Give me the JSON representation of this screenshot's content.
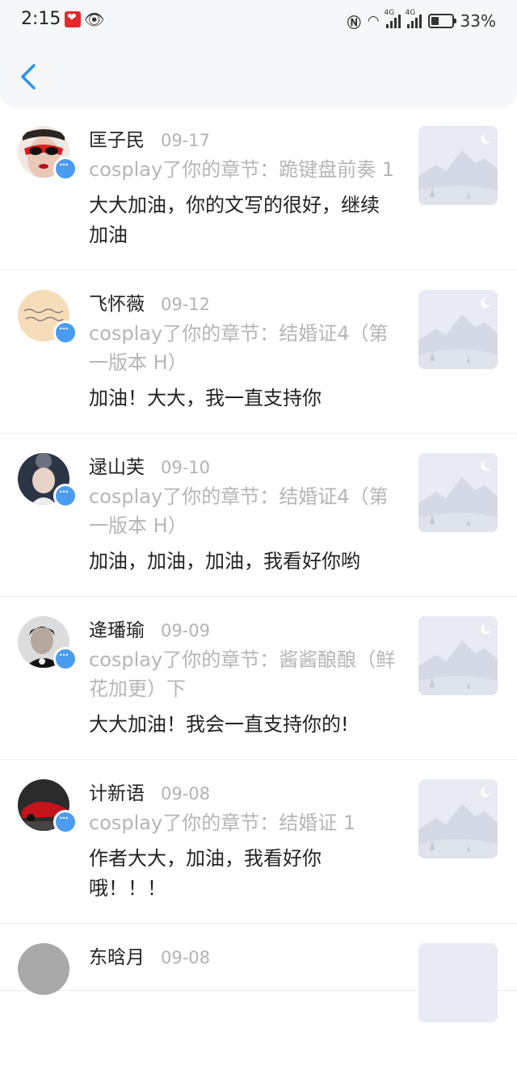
{
  "status_bar": {
    "time": "2:15",
    "battery": "33%",
    "network_1": "4G",
    "network_2": "4G"
  },
  "header": {
    "back_icon": "chevron-left-icon"
  },
  "comments": [
    {
      "user": "匡子民",
      "date": "09-17",
      "chapter": "cosplay了你的章节：跪键盘前奏 1",
      "comment": "大大加油，你的文写的很好，继续加油"
    },
    {
      "user": "飞怀薇",
      "date": "09-12",
      "chapter": "cosplay了你的章节：结婚证4（第一版本 H）",
      "comment": "加油！大大，我一直支持你"
    },
    {
      "user": "逯山芙",
      "date": "09-10",
      "chapter": "cosplay了你的章节：结婚证4（第一版本 H）",
      "comment": "加油，加油，加油，我看好你哟"
    },
    {
      "user": "逄璠瑜",
      "date": "09-09",
      "chapter": "cosplay了你的章节：酱酱酿酿（鲜花加更）下",
      "comment": "大大加油！我会一直支持你的!"
    },
    {
      "user": "计新语",
      "date": "09-08",
      "chapter": "cosplay了你的章节：结婚证 1",
      "comment": "作者大大，加油，我看好你哦！！！"
    },
    {
      "user": "东晗月",
      "date": "09-08",
      "chapter": "",
      "comment": ""
    }
  ]
}
